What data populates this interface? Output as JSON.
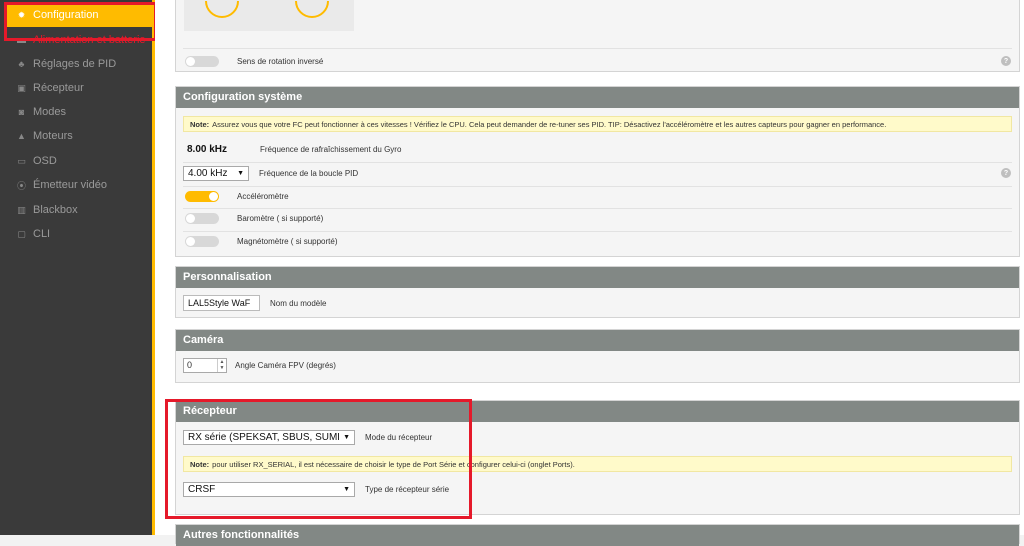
{
  "colors": {
    "accent": "#ffbb00",
    "panel_header": "#828885",
    "sidebar_bg": "#3a3a3a",
    "highlight_box": "#e5192a"
  },
  "sidebar": {
    "items": [
      {
        "label": "Configuration",
        "icon": "gear-icon",
        "active": true
      },
      {
        "label": "Alimentation et batterie",
        "icon": "battery-icon"
      },
      {
        "label": "Réglages de PID",
        "icon": "sitemap-icon"
      },
      {
        "label": "Récepteur",
        "icon": "receiver-icon"
      },
      {
        "label": "Modes",
        "icon": "modes-icon"
      },
      {
        "label": "Moteurs",
        "icon": "motor-icon"
      },
      {
        "label": "OSD",
        "icon": "osd-icon"
      },
      {
        "label": "Émetteur vidéo",
        "icon": "antenna-icon"
      },
      {
        "label": "Blackbox",
        "icon": "blackbox-icon"
      },
      {
        "label": "CLI",
        "icon": "terminal-icon"
      }
    ]
  },
  "motor_panel": {
    "reverse_label": "Sens de rotation inversé",
    "reverse_on": false
  },
  "system": {
    "title": "Configuration système",
    "note_label": "Note:",
    "note_text": "Assurez vous que votre FC peut fonctionner à ces vitesses ! Vérifiez le CPU. Cela peut demander de re-tuner ses PID. TIP: Désactivez l'accéléromètre et les autres capteurs pour gagner en performance.",
    "gyro_value": "8.00 kHz",
    "gyro_label": "Fréquence de rafraîchissement du Gyro",
    "pid_value": "4.00 kHz",
    "pid_label": "Fréquence de la boucle PID",
    "acc_label": "Accéléromètre",
    "acc_on": true,
    "baro_label": "Baromètre ( si supporté)",
    "baro_on": false,
    "mag_label": "Magnétomètre ( si supporté)",
    "mag_on": false
  },
  "personal": {
    "title": "Personnalisation",
    "name_value": "LAL5Style WaF",
    "name_label": "Nom du modèle"
  },
  "camera": {
    "title": "Caméra",
    "angle_value": "0",
    "angle_label": "Angle Caméra FPV (degrés)"
  },
  "receiver": {
    "title": "Récepteur",
    "mode_value": "RX série (SPEKSAT, SBUS, SUMD",
    "mode_label": "Mode du récepteur",
    "note_label": "Note:",
    "note_text": "pour utiliser RX_SERIAL, il est nécessaire de choisir le type de Port Série et configurer celui-ci (onglet Ports).",
    "serial_value": "CRSF",
    "serial_label": "Type de récepteur série"
  },
  "other": {
    "title": "Autres fonctionnalités"
  }
}
